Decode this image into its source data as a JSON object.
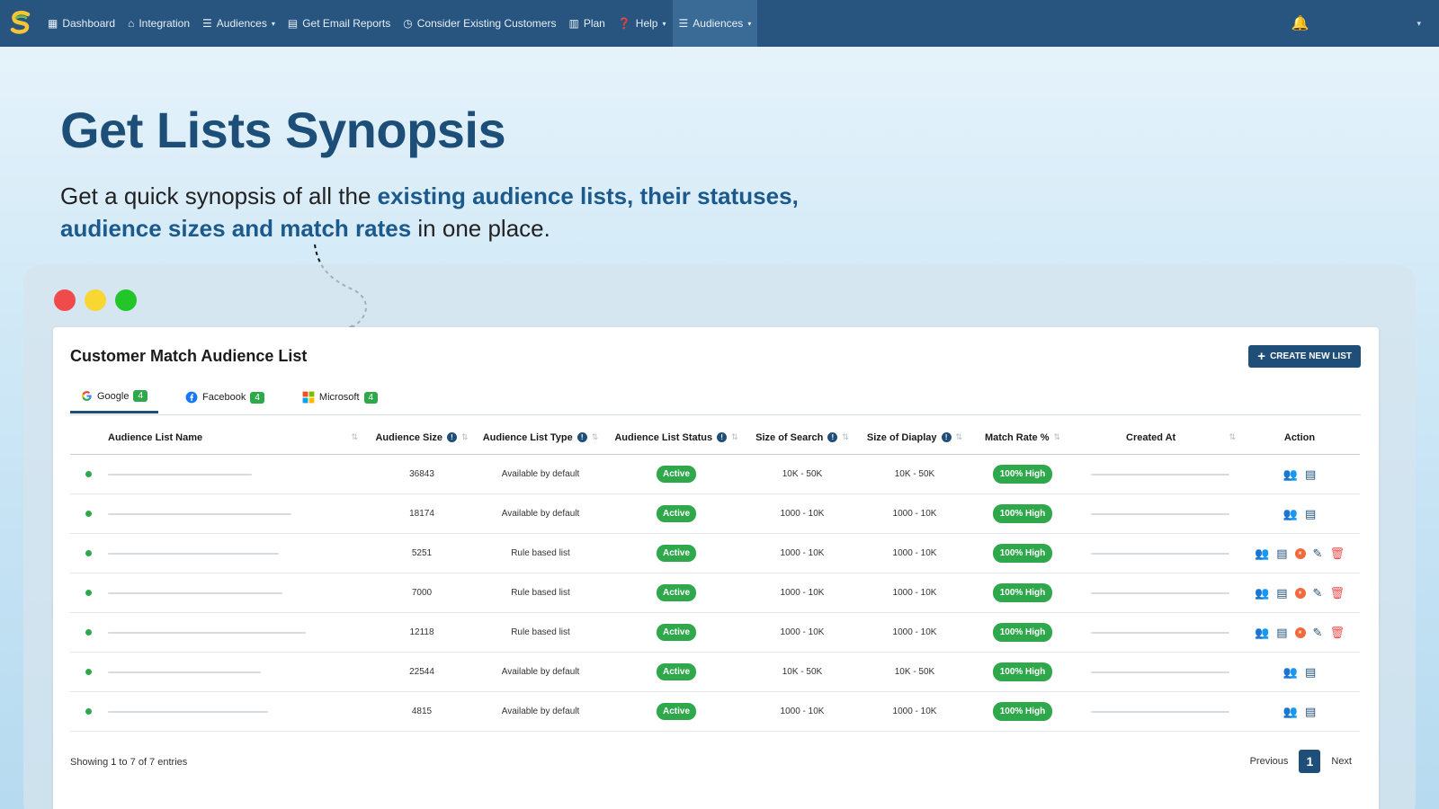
{
  "nav": {
    "items": [
      {
        "label": "Dashboard",
        "icon": "dashboard-icon",
        "glyph": "▦"
      },
      {
        "label": "Integration",
        "icon": "integration-icon",
        "glyph": "⌂"
      },
      {
        "label": "Audiences",
        "icon": "list-icon",
        "glyph": "☰",
        "caret": "▾"
      },
      {
        "label": "Get Email Reports",
        "icon": "clipboard-icon",
        "glyph": "▤"
      },
      {
        "label": "Consider Existing Customers",
        "icon": "history-icon",
        "glyph": "◷"
      },
      {
        "label": "Plan",
        "icon": "plan-icon",
        "glyph": "▥"
      },
      {
        "label": "Help",
        "icon": "help-icon",
        "glyph": "❓",
        "caret": "▾"
      },
      {
        "label": "Audiences",
        "icon": "list-icon",
        "glyph": "☰",
        "caret": "▾"
      }
    ]
  },
  "hero": {
    "title": "Get Lists Synopsis",
    "sub_plain_1": "Get a quick synopsis of all the ",
    "sub_highlight_1": "existing audience lists, their statuses,",
    "sub_highlight_2": "audience sizes and match rates",
    "sub_plain_2": " in one place."
  },
  "card": {
    "title": "Customer Match Audience List",
    "create_button": "CREATE NEW LIST",
    "tabs": [
      {
        "label": "Google",
        "count": "4"
      },
      {
        "label": "Facebook",
        "count": "4"
      },
      {
        "label": "Microsoft",
        "count": "4"
      }
    ],
    "columns": [
      "Audience List Name",
      "Audience Size",
      "Audience List Type",
      "Audience List Status",
      "Size of Search",
      "Size of Diaplay",
      "Match Rate %",
      "Created At",
      "Action"
    ],
    "rows": [
      {
        "size": "36843",
        "type": "Available by default",
        "status": "Active",
        "search": "10K - 50K",
        "display": "10K - 50K",
        "match": "100% High",
        "rule": false
      },
      {
        "size": "18174",
        "type": "Available by default",
        "status": "Active",
        "search": "1000 - 10K",
        "display": "1000 - 10K",
        "match": "100% High",
        "rule": false
      },
      {
        "size": "5251",
        "type": "Rule based list",
        "status": "Active",
        "search": "1000 - 10K",
        "display": "1000 - 10K",
        "match": "100% High",
        "rule": true
      },
      {
        "size": "7000",
        "type": "Rule based list",
        "status": "Active",
        "search": "1000 - 10K",
        "display": "1000 - 10K",
        "match": "100% High",
        "rule": true
      },
      {
        "size": "12118",
        "type": "Rule based list",
        "status": "Active",
        "search": "1000 - 10K",
        "display": "1000 - 10K",
        "match": "100% High",
        "rule": true
      },
      {
        "size": "22544",
        "type": "Available by default",
        "status": "Active",
        "search": "10K - 50K",
        "display": "10K - 50K",
        "match": "100% High",
        "rule": false
      },
      {
        "size": "4815",
        "type": "Available by default",
        "status": "Active",
        "search": "1000 - 10K",
        "display": "1000 - 10K",
        "match": "100% High",
        "rule": false
      }
    ],
    "footer": "Showing 1 to 7 of 7 entries",
    "pager": {
      "previous": "Previous",
      "page": "1",
      "next": "Next"
    }
  },
  "colors": {
    "nav": "#27557f",
    "title": "#1d4e78",
    "accent": "#1f4e79",
    "success": "#2ea84a"
  }
}
